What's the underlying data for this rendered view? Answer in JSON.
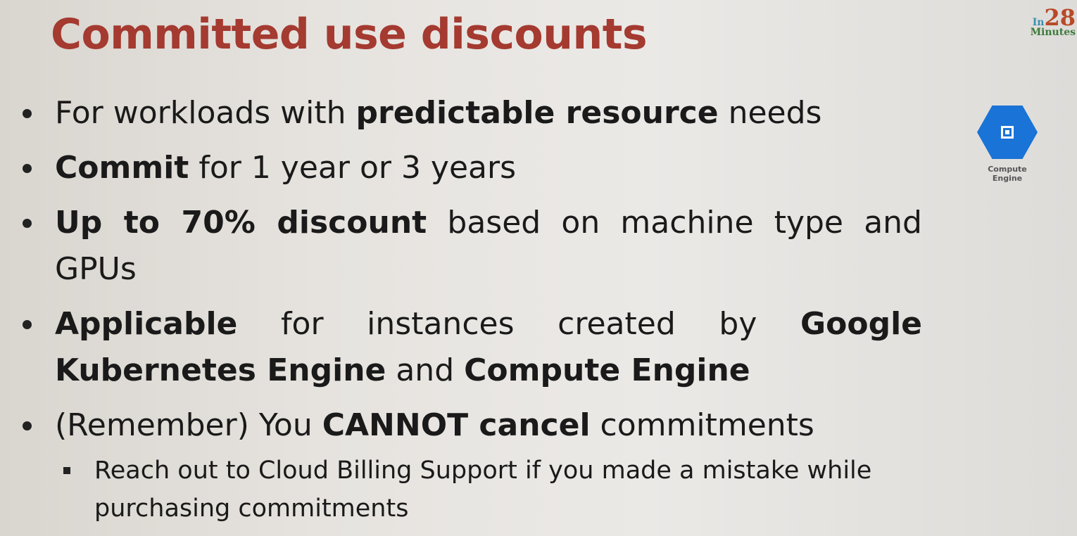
{
  "title": "Committed use discounts",
  "logo": {
    "prefix": "In",
    "number": "28",
    "suffix": "Minutes"
  },
  "service_icon": {
    "name": "compute-engine-icon",
    "label_line1": "Compute",
    "label_line2": "Engine",
    "color": "#1a73d6"
  },
  "bullets": [
    {
      "segments": [
        {
          "text": "For workloads with ",
          "bold": false
        },
        {
          "text": "predictable resource",
          "bold": true
        },
        {
          "text": " needs",
          "bold": false
        }
      ]
    },
    {
      "segments": [
        {
          "text": "Commit",
          "bold": true
        },
        {
          "text": " for 1 year or 3 years",
          "bold": false
        }
      ]
    },
    {
      "segments": [
        {
          "text": "Up to 70% discount",
          "bold": true
        },
        {
          "text": " based on machine type and GPUs",
          "bold": false
        }
      ]
    },
    {
      "segments": [
        {
          "text": "Applicable",
          "bold": true
        },
        {
          "text": " for instances created by ",
          "bold": false
        },
        {
          "text": "Google Kubernetes Engine",
          "bold": true
        },
        {
          "text": " and ",
          "bold": false
        },
        {
          "text": "Compute Engine",
          "bold": true
        }
      ]
    },
    {
      "segments": [
        {
          "text": "(Remember) You ",
          "bold": false
        },
        {
          "text": "CANNOT cancel",
          "bold": true
        },
        {
          "text": " commitments",
          "bold": false
        }
      ]
    }
  ],
  "sub_bullet": "Reach out to Cloud Billing Support if you made a mistake while purchasing commitments"
}
